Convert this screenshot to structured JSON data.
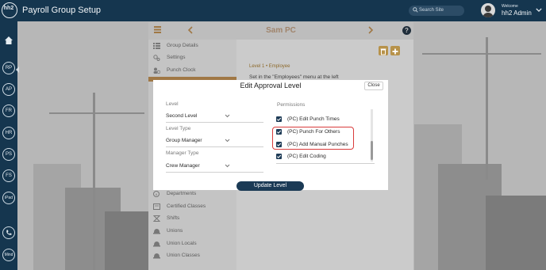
{
  "app": {
    "title": "Payroll Group Setup",
    "logo_text": "hh2"
  },
  "header": {
    "search_placeholder": "Search Site",
    "welcome": "Welcome",
    "user_name": "hh2 Admin"
  },
  "rail": {
    "items": [
      "RP",
      "AP",
      "FR",
      "HR",
      "PS",
      "FS",
      "iPad",
      "Mind"
    ]
  },
  "panel": {
    "title": "Sam PC",
    "side_items": [
      "Group Details",
      "Settings",
      "Punch Clock",
      "Departments",
      "Certified Classes",
      "Shifts",
      "Unions",
      "Union Locals",
      "Union Classes"
    ],
    "level_heading": "Level 1 • Employee",
    "level_text": "Set in the \"Employees\" menu at the left"
  },
  "modal": {
    "title": "Edit Approval Level",
    "close_label": "Close",
    "level_label": "Level",
    "level_value": "Second Level",
    "level_type_label": "Level Type",
    "level_type_value": "Group Manager",
    "manager_type_label": "Manager Type",
    "manager_type_value": "Crew Manager",
    "permissions_label": "Permissions",
    "permissions": [
      {
        "label": "(PC) Edit Punch Times",
        "checked": true
      },
      {
        "label": "(PC) Punch For Others",
        "checked": true
      },
      {
        "label": "(PC) Add Manual Punches",
        "checked": true
      },
      {
        "label": "(PC) Edit Coding",
        "checked": true
      }
    ],
    "update_label": "Update Level"
  },
  "colors": {
    "topbar": "#15364f",
    "accent": "#1b3a55",
    "highlight": "#d93b3b",
    "panel_title": "#a0846b"
  }
}
